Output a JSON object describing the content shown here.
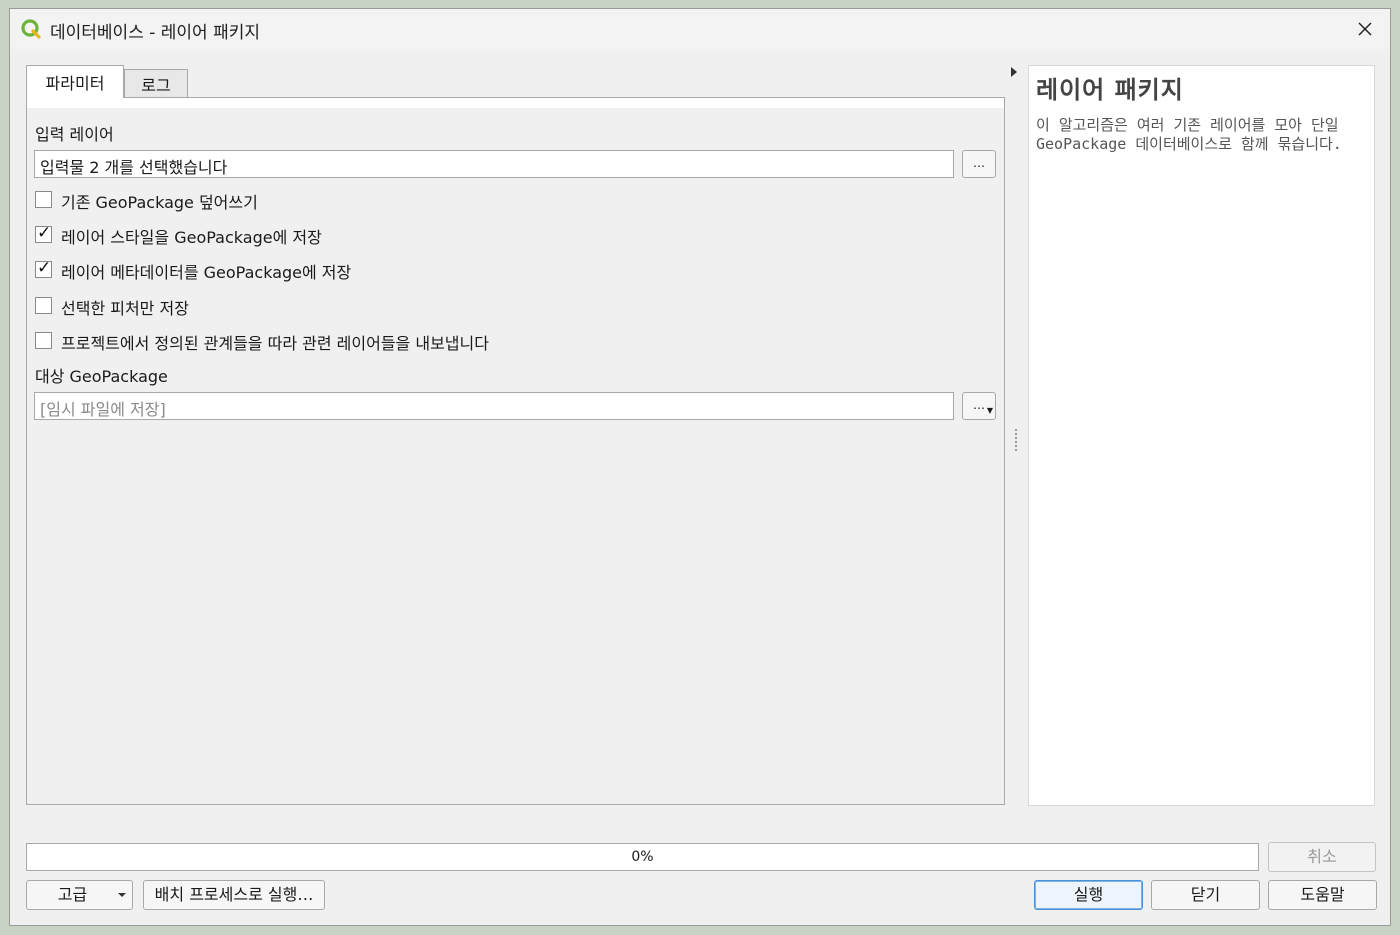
{
  "window": {
    "title": "데이터베이스 - 레이어 패키지"
  },
  "tabs": [
    {
      "label": "파라미터"
    },
    {
      "label": "로그"
    }
  ],
  "params": {
    "input_layer_label": "입력 레이어",
    "input_layer_value": "입력물 2 개를 선택했습니다",
    "browse_label": "…",
    "options": [
      {
        "label": "기존 GeoPackage 덮어쓰기",
        "checked": false
      },
      {
        "label": "레이어 스타일을 GeoPackage에 저장",
        "checked": true
      },
      {
        "label": "레이어 메타데이터를 GeoPackage에 저장",
        "checked": true
      },
      {
        "label": "선택한 피처만 저장",
        "checked": false
      },
      {
        "label": "프로젝트에서 정의된 관계들을 따라 관련 레이어들을 내보냅니다",
        "checked": false
      }
    ],
    "target_label": "대상 GeoPackage",
    "target_placeholder": "[임시 파일에 저장]"
  },
  "help": {
    "title": "레이어 패키지",
    "description": "이 알고리즘은 여러 기존 레이어를 모아 단일 GeoPackage 데이터베이스로 함께 묶습니다."
  },
  "progress": {
    "text": "0%",
    "value": 0
  },
  "buttons": {
    "cancel": "취소",
    "advanced": "고급",
    "batch": "배치 프로세스로 실행…",
    "run": "실행",
    "close": "닫기",
    "help": "도움말"
  },
  "colors": {
    "qgis_green": "#6cb33e",
    "default_button_border": "#4a90d9"
  }
}
